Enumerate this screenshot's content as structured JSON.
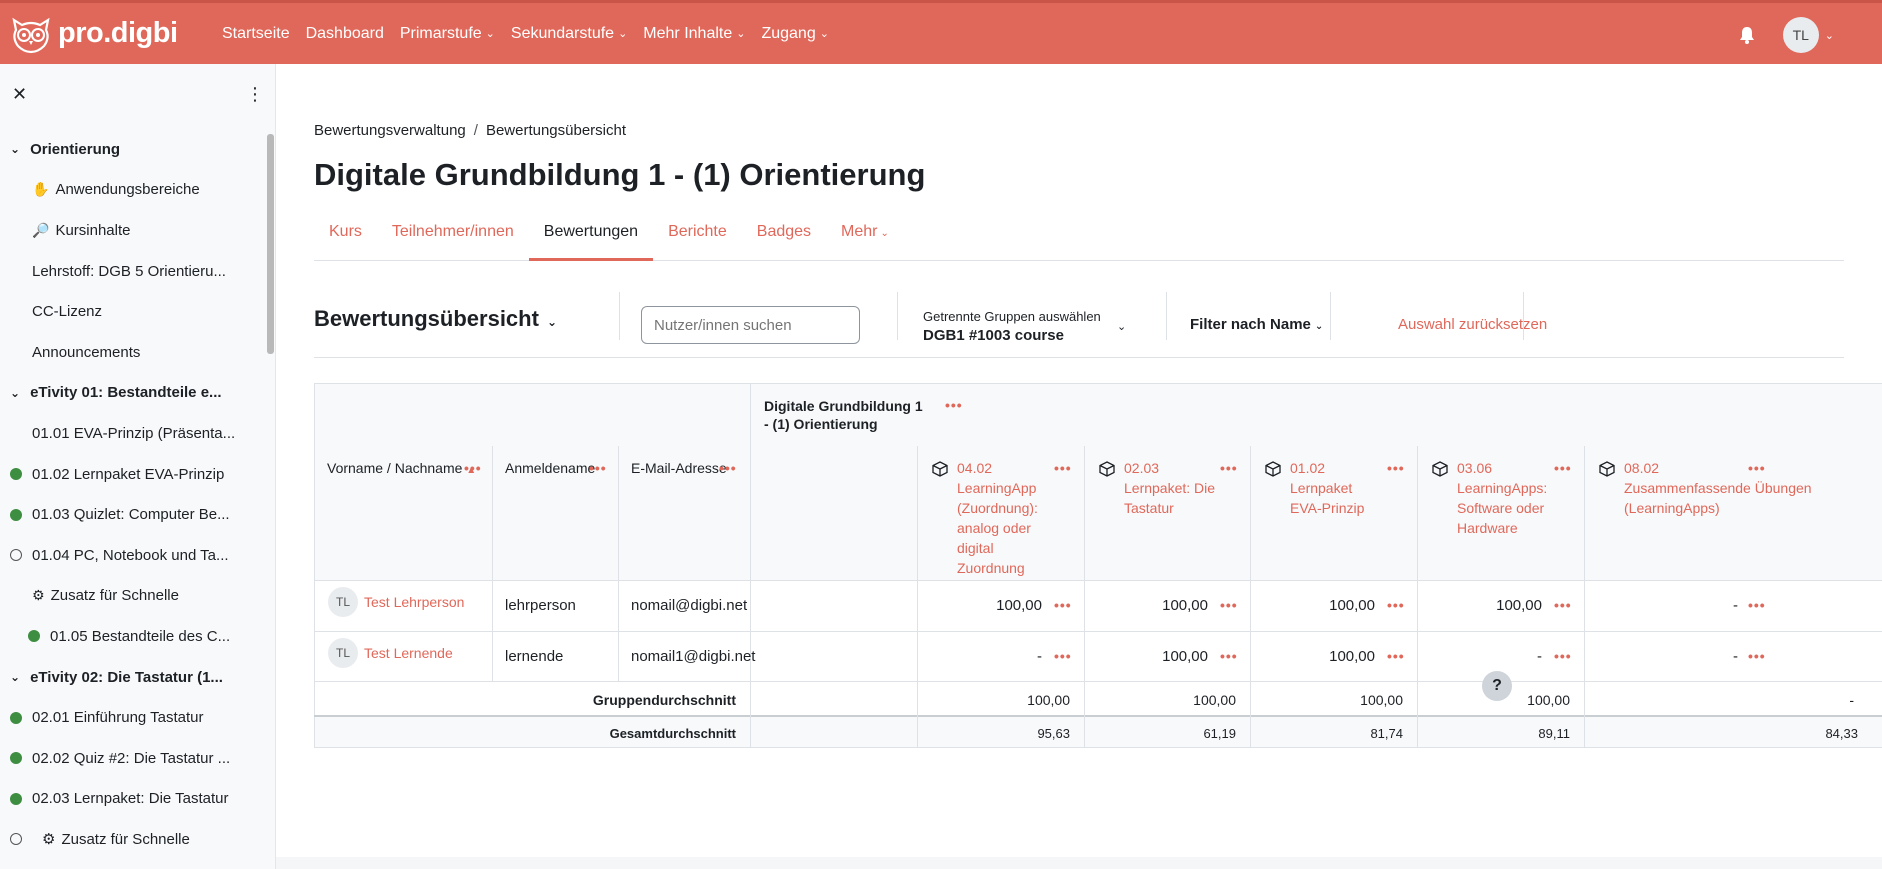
{
  "brand": {
    "name": "pro.digbi",
    "accent": "#e0685a"
  },
  "nav": [
    {
      "label": "Startseite"
    },
    {
      "label": "Dashboard"
    },
    {
      "label": "Primarstufe",
      "dropdown": true
    },
    {
      "label": "Sekundarstufe",
      "dropdown": true
    },
    {
      "label": "Mehr Inhalte",
      "dropdown": true
    },
    {
      "label": "Zugang",
      "dropdown": true
    }
  ],
  "user": {
    "initials": "TL"
  },
  "sidebar": {
    "items": [
      {
        "type": "section",
        "label": "Orientierung"
      },
      {
        "type": "emoji",
        "emoji": "✋",
        "label": "Anwendungsbereiche"
      },
      {
        "type": "emoji",
        "emoji": "🔎",
        "label": "Kursinhalte"
      },
      {
        "type": "plain",
        "label": "Lehrstoff: DGB 5 Orientieru..."
      },
      {
        "type": "plain",
        "label": "CC-Lizenz"
      },
      {
        "type": "plain",
        "label": "Announcements"
      },
      {
        "type": "section",
        "label": "eTivity 01: Bestandteile e..."
      },
      {
        "type": "plain",
        "label": "01.01 EVA-Prinzip (Präsenta..."
      },
      {
        "type": "done",
        "label": "01.02 Lernpaket EVA-Prinzip"
      },
      {
        "type": "done",
        "label": "01.03 Quizlet: Computer Be..."
      },
      {
        "type": "open",
        "label": "01.04 PC, Notebook und Ta..."
      },
      {
        "type": "emoji",
        "emoji": "⚙",
        "label": "Zusatz für Schnelle"
      },
      {
        "type": "done-indent",
        "label": "01.05 Bestandteile des C..."
      },
      {
        "type": "section",
        "label": "eTivity 02: Die Tastatur (1..."
      },
      {
        "type": "done",
        "label": "02.01 Einführung Tastatur"
      },
      {
        "type": "done",
        "label": "02.02 Quiz #2: Die Tastatur ..."
      },
      {
        "type": "done",
        "label": "02.03 Lernpaket: Die Tastatur"
      },
      {
        "type": "open-emoji",
        "emoji": "⚙",
        "label": "Zusatz für Schnelle"
      }
    ]
  },
  "breadcrumb": [
    "Bewertungsverwaltung",
    "Bewertungsübersicht"
  ],
  "page_title": "Digitale Grundbildung 1 - (1) Orientierung",
  "tabs": [
    {
      "label": "Kurs"
    },
    {
      "label": "Teilnehmer/innen"
    },
    {
      "label": "Bewertungen",
      "active": true
    },
    {
      "label": "Berichte"
    },
    {
      "label": "Badges"
    },
    {
      "label": "Mehr",
      "dropdown": true
    }
  ],
  "toolbar": {
    "title": "Bewertungsübersicht",
    "search_placeholder": "Nutzer/innen suchen",
    "group_label": "Getrennte Gruppen auswählen",
    "group_value": "DGB1 #1003 course",
    "filter_label": "Filter nach Name",
    "reset_label": "Auswahl zurücksetzen"
  },
  "grader": {
    "category": "Digitale Grundbildung 1 - (1) Orientierung",
    "columns": {
      "name": "Vorname / Nachname",
      "username": "Anmeldename",
      "email": "E-Mail-Adresse"
    },
    "items": [
      {
        "code": "04.02",
        "title": "LearningApp (Zuordnung): analog oder digital Zuordnung"
      },
      {
        "code": "02.03",
        "title": "Lernpaket: Die Tastatur"
      },
      {
        "code": "01.02",
        "title": "Lernpaket EVA-Prinzip"
      },
      {
        "code": "03.06",
        "title": "LearningApps: Software oder Hardware"
      },
      {
        "code": "08.02",
        "title": "Zusammenfassende Übungen (LearningApps)"
      }
    ],
    "users": [
      {
        "initials": "TL",
        "name": "Test Lehrperson",
        "username": "lehrperson",
        "email": "nomail@digbi.net",
        "grades": [
          "100,00",
          "100,00",
          "100,00",
          "100,00",
          "-"
        ]
      },
      {
        "initials": "TL",
        "name": "Test Lernende",
        "username": "lernende",
        "email": "nomail1@digbi.net",
        "grades": [
          "-",
          "100,00",
          "100,00",
          "-",
          "-"
        ]
      }
    ],
    "group_avg": {
      "label": "Gruppendurchschnitt",
      "values": [
        "100,00",
        "100,00",
        "100,00",
        "100,00",
        "-"
      ]
    },
    "overall_avg": {
      "label": "Gesamtdurchschnitt",
      "values": [
        "95,63",
        "61,19",
        "81,74",
        "89,11",
        "84,33"
      ]
    }
  },
  "help_label": "?"
}
